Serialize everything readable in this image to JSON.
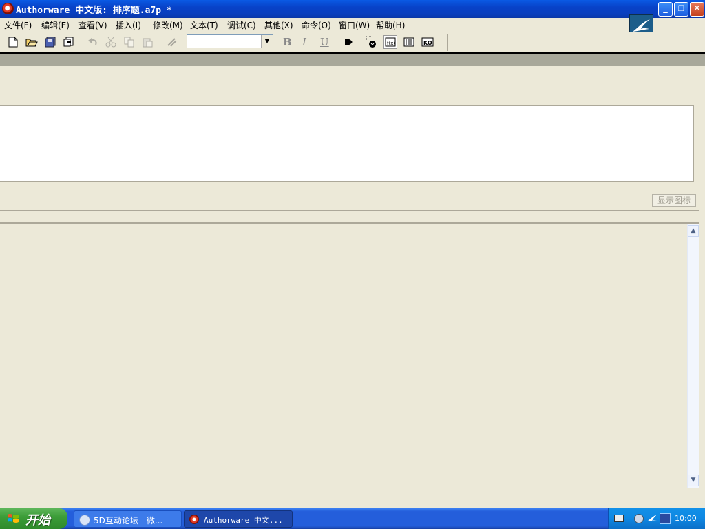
{
  "window": {
    "title": "Authorware 中文版: 排序题.a7p *",
    "controls": {
      "minimize": "_",
      "restore": "❐",
      "close": "✕"
    }
  },
  "menu": [
    "文件(F)",
    "编辑(E)",
    "查看(V)",
    "插入(I)",
    "修改(M)",
    "文本(T)",
    "调试(C)",
    "其他(X)",
    "命令(O)",
    "窗口(W)",
    "帮助(H)"
  ],
  "toolbar": {
    "font_combo_value": "",
    "bold": "B",
    "italic": "I",
    "underline": "U",
    "icons": [
      "new-file-icon",
      "open-icon",
      "save-all-icon",
      "import-icon",
      "undo-icon",
      "cut-icon",
      "copy-icon",
      "paste-icon",
      "find-icon",
      "run-icon",
      "control-panel-icon",
      "functions-icon",
      "variables-icon",
      "knowledge-objects-icon"
    ]
  },
  "panel": {
    "show_icon_button": "显示图标"
  },
  "scrollbar": {
    "up": "▲",
    "down": "▼"
  },
  "taskbar": {
    "start_label": "开始",
    "tasks": [
      {
        "label": "5D互动论坛 - 微..."
      },
      {
        "label": "Authorware 中文..."
      }
    ],
    "clock": "10:00"
  },
  "colors": {
    "titlebar": "#0a5ae4",
    "taskbar": "#245edb",
    "start_button": "#3c9d38",
    "workspace": "#ece9d8"
  }
}
